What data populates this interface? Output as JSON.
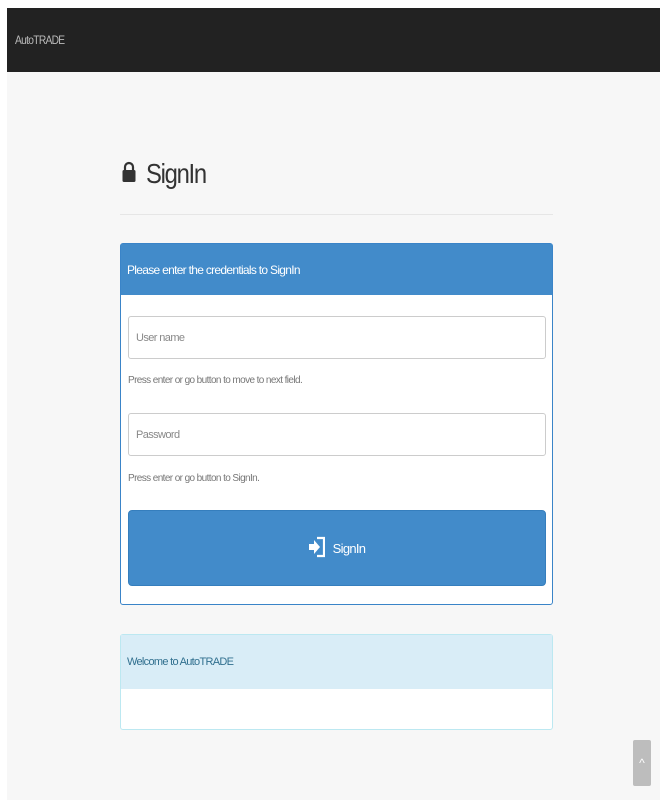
{
  "navbar": {
    "brand": "AutoTRADE"
  },
  "header": {
    "title": "SignIn",
    "icon": "lock-icon"
  },
  "signin_panel": {
    "heading": "Please enter the credentials to SignIn",
    "username": {
      "placeholder": "User name",
      "value": ""
    },
    "username_help": "Press enter or go button to move to next field.",
    "password": {
      "placeholder": "Password",
      "value": ""
    },
    "password_help": "Press enter or go button to SignIn.",
    "signin_button": {
      "label": "SignIn",
      "icon": "sign-in-icon"
    }
  },
  "info_panel": {
    "heading": "Welcome to AutoTRADE"
  },
  "scroll_top": {
    "label": "^"
  },
  "colors": {
    "navbar": "#222222",
    "primary": "#428bca",
    "info_heading": "#d9edf7",
    "info_text": "#31708f"
  }
}
